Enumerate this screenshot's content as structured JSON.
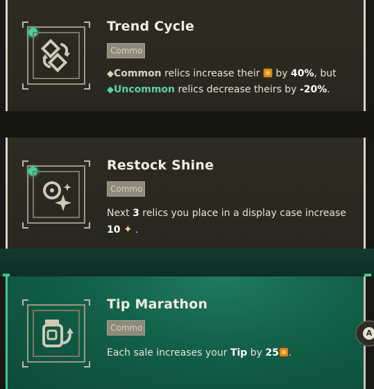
{
  "cards": [
    {
      "title": "Trend Cycle",
      "rarity": "Commo",
      "icon": "recycle-swap-icon",
      "desc_line1_a": "Common",
      "desc_line1_b": " relics increase their ",
      "desc_line1_c": " by ",
      "desc_line1_d": "40%",
      "desc_line1_e": ", but",
      "desc_line2_a": "Uncommon",
      "desc_line2_b": " relics decrease theirs by ",
      "desc_line2_c": "-20%",
      "desc_line2_d": "."
    },
    {
      "title": "Restock Shine",
      "rarity": "Commo",
      "icon": "coin-sparkle-icon",
      "desc_a": "Next ",
      "desc_b": "3",
      "desc_c": " relics you place in a display case increase",
      "desc_d": "10",
      "desc_e": " ."
    },
    {
      "title": "Tip Marathon",
      "rarity": "Commo",
      "icon": "tip-jar-arrow-icon",
      "desc_a": "Each sale increases your ",
      "desc_b": "Tip",
      "desc_c": " by ",
      "desc_d": "25",
      "desc_e": "."
    }
  ],
  "controller": {
    "button_label": "A"
  },
  "colors": {
    "accent_green": "#3fd595",
    "uncommon_text": "#5fd3a0",
    "selected_card": "#126048"
  }
}
